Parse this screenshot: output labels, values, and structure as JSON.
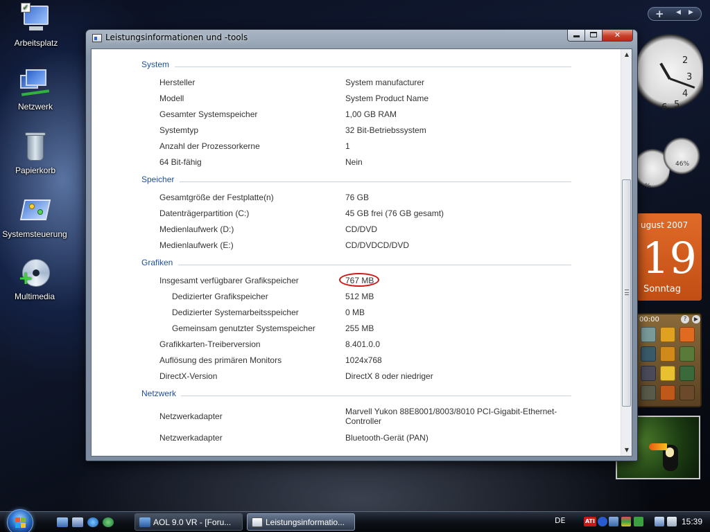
{
  "desktop": {
    "icons": [
      {
        "label": "Arbeitsplatz",
        "icon": "computer-icon"
      },
      {
        "label": "Netzwerk",
        "icon": "network-icon"
      },
      {
        "label": "Papierkorb",
        "icon": "recycle-bin-icon"
      },
      {
        "label": "Systemsteuerung",
        "icon": "control-panel-icon"
      },
      {
        "label": "Multimedia",
        "icon": "multimedia-icon"
      }
    ]
  },
  "sidebar": {
    "calendar": {
      "month": "ugust 2007",
      "day": "19",
      "weekday": "Sonntag"
    },
    "meter_left": "%",
    "meter_right": "46%",
    "puzzle_time": "00:00",
    "clock_numbers": [
      "2",
      "3",
      "4",
      "5",
      "6"
    ]
  },
  "window": {
    "title": "Leistungsinformationen und -tools",
    "sections": [
      {
        "heading": "System",
        "rows": [
          {
            "label": "Hersteller",
            "value": "System manufacturer"
          },
          {
            "label": "Modell",
            "value": "System Product Name"
          },
          {
            "label": "Gesamter Systemspeicher",
            "value": "1,00 GB RAM"
          },
          {
            "label": "Systemtyp",
            "value": "32 Bit-Betriebssystem"
          },
          {
            "label": "Anzahl der Prozessorkerne",
            "value": "1"
          },
          {
            "label": "64 Bit-fähig",
            "value": "Nein"
          }
        ]
      },
      {
        "heading": "Speicher",
        "rows": [
          {
            "label": "Gesamtgröße der Festplatte(n)",
            "value": "76 GB"
          },
          {
            "label": "Datenträgerpartition (C:)",
            "value": "45 GB frei (76 GB gesamt)"
          },
          {
            "label": "Medienlaufwerk (D:)",
            "value": "CD/DVD"
          },
          {
            "label": "Medienlaufwerk (E:)",
            "value": "CD/DVDCD/DVD"
          }
        ]
      },
      {
        "heading": "Grafiken",
        "rows": [
          {
            "label": "Insgesamt verfügbarer Grafikspeicher",
            "value": "767 MB"
          },
          {
            "label": "Dedizierter Grafikspeicher",
            "value": "512 MB"
          },
          {
            "label": "Dedizierter Systemarbeitsspeicher",
            "value": "0 MB"
          },
          {
            "label": "Gemeinsam genutzter Systemspeicher",
            "value": "255 MB"
          },
          {
            "label": "Grafikkarten-Treiberversion",
            "value": "8.401.0.0"
          },
          {
            "label": "Auflösung des primären Monitors",
            "value": "1024x768"
          },
          {
            "label": "DirectX-Version",
            "value": "DirectX 8 oder niedriger"
          }
        ]
      },
      {
        "heading": "Netzwerk",
        "rows": [
          {
            "label": "Netzwerkadapter",
            "value": "Marvell Yukon 88E8001/8003/8010 PCI-Gigabit-Ethernet-Controller"
          },
          {
            "label": "Netzwerkadapter",
            "value": "Bluetooth-Gerät (PAN)"
          }
        ]
      }
    ]
  },
  "taskbar": {
    "tasks": [
      {
        "label": "AOL 9.0 VR - [Foru...",
        "active": false
      },
      {
        "label": "Leistungsinformatio...",
        "active": true
      }
    ],
    "language": "DE",
    "clock": "15:39",
    "tray_badge": "ATI"
  },
  "colors": {
    "section_heading": "#1e4f9a",
    "highlight_circle": "#d01818",
    "calendar_orange": "#e06a28"
  }
}
